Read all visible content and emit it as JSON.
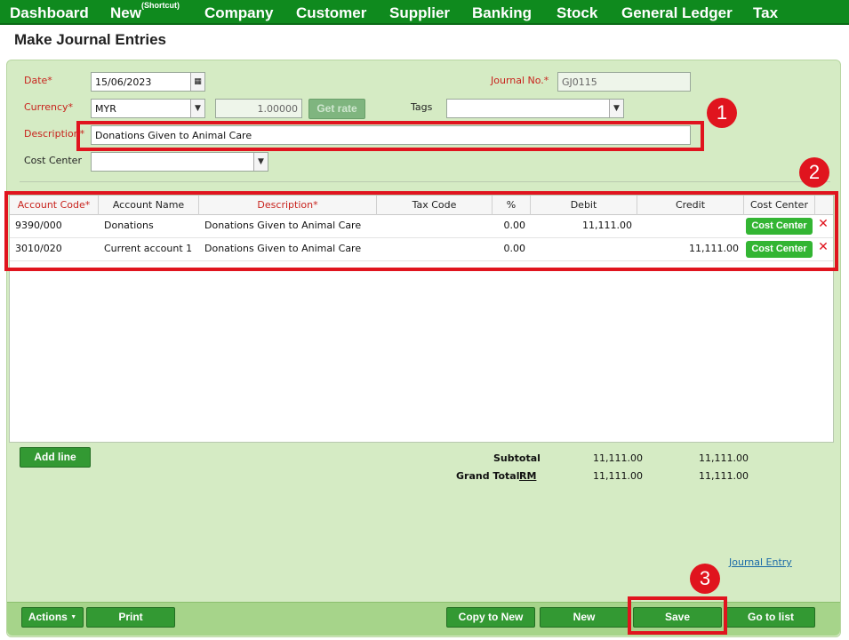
{
  "nav": {
    "items": [
      "Dashboard",
      "New",
      "Company",
      "Customer",
      "Supplier",
      "Banking",
      "Stock",
      "General Ledger",
      "Tax"
    ],
    "new_superscript": "(Shortcut)"
  },
  "page": {
    "title": "Make Journal Entries"
  },
  "form": {
    "date_label": "Date*",
    "date_value": "15/06/2023",
    "journal_no_label": "Journal No.*",
    "journal_no_value": "GJ0115",
    "currency_label": "Currency*",
    "currency_value": "MYR",
    "rate_value": "1.00000",
    "get_rate_label": "Get rate",
    "tags_label": "Tags",
    "tags_value": "",
    "description_label": "Description*",
    "description_value": "Donations Given to Animal Care",
    "cost_center_label": "Cost Center",
    "cost_center_value": ""
  },
  "grid": {
    "headers": [
      "Account Code*",
      "Account Name",
      "Description*",
      "Tax Code",
      "%",
      "Debit",
      "Credit",
      "Cost Center"
    ],
    "rows": [
      {
        "account_code": "9390/000",
        "account_name": "Donations",
        "description": "Donations Given to Animal Care",
        "tax_code": "",
        "percent": "0.00",
        "debit": "11,111.00",
        "credit": "",
        "cost_center": "Cost Center"
      },
      {
        "account_code": "3010/020",
        "account_name": "Current account 1",
        "description": "Donations Given to Animal Care",
        "tax_code": "",
        "percent": "0.00",
        "debit": "",
        "credit": "11,111.00",
        "cost_center": "Cost Center"
      }
    ],
    "delete_glyph": "✕"
  },
  "totals": {
    "add_line_label": "Add line",
    "subtotal_label": "Subtotal",
    "subtotal_debit": "11,111.00",
    "subtotal_credit": "11,111.00",
    "grand_total_label": "Grand Total",
    "currency_symbol": "RM",
    "grand_debit": "11,111.00",
    "grand_credit": "11,111.00"
  },
  "links": {
    "journal_entry": "Journal Entry"
  },
  "actions": {
    "actions_label": "Actions",
    "print_label": "Print",
    "copy_to_new_label": "Copy to New",
    "new_label": "New",
    "save_label": "Save",
    "go_to_list_label": "Go to list"
  },
  "annotations": {
    "marker_1": "1",
    "marker_2": "2",
    "marker_3": "3"
  },
  "colors": {
    "nav_green": "#0f8a1e",
    "panel_green": "#d5ebc4",
    "button_green": "#339933",
    "required_red": "#c8231d",
    "highlight_red": "#e0141e"
  }
}
